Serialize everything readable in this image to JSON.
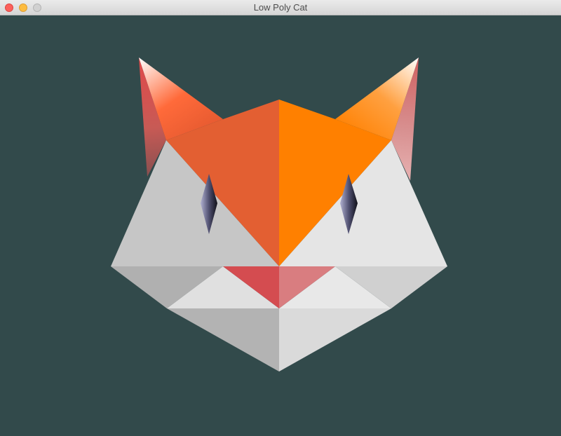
{
  "window": {
    "title": "Low Poly Cat",
    "background_color": "#324a4b"
  },
  "titlebar_buttons": [
    "close",
    "minimize",
    "zoom"
  ],
  "colors": {
    "ear_orange": "#ff8c1a",
    "head_orange_left": "#e35f32",
    "head_orange_right": "#ff8000",
    "face_white_left": "#c6c6c6",
    "face_white_right": "#e5e5e5",
    "nose_red_left": "#d44c50",
    "nose_red_right": "#d97d80",
    "eye_dark": "#1a1a2a",
    "eye_light": "#a0a0c0"
  }
}
